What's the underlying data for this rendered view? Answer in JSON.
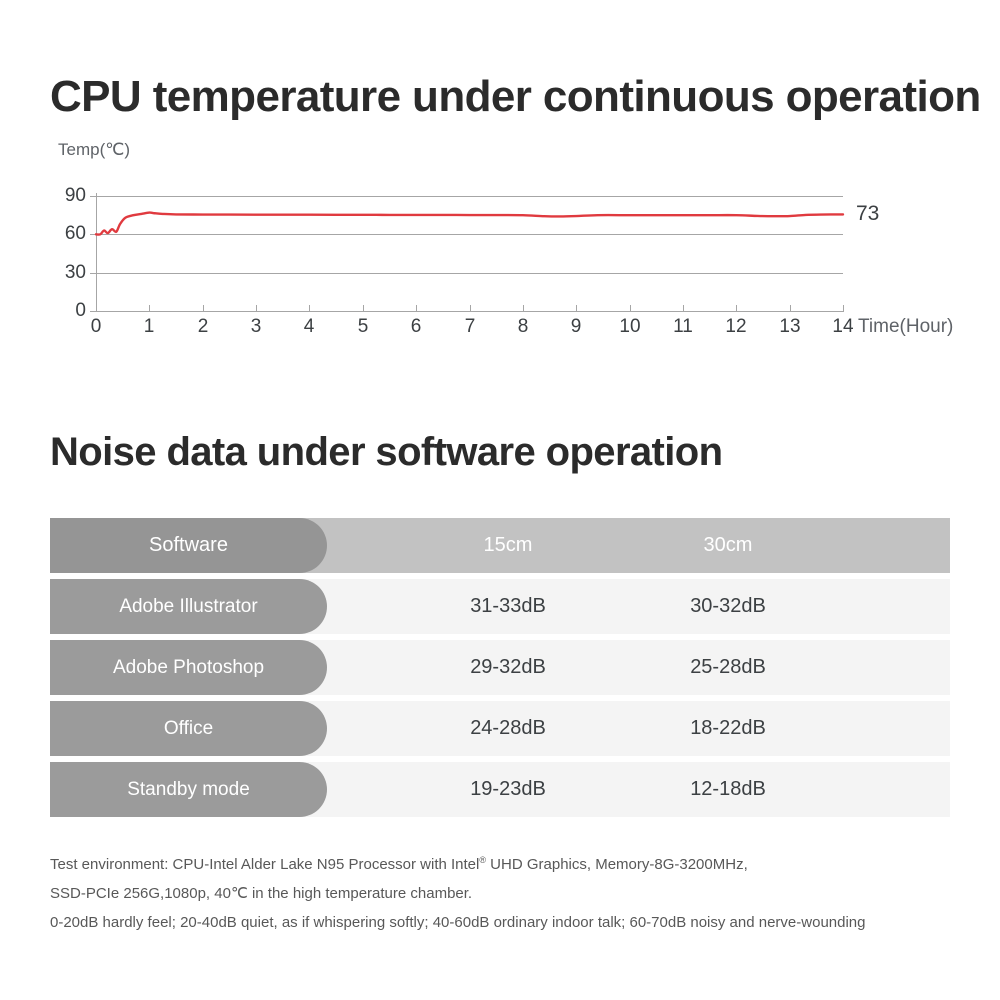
{
  "sections": {
    "cpu_title": "CPU temperature under continuous operation",
    "noise_title": "Noise data under software operation"
  },
  "chart_data": {
    "type": "line",
    "title": "CPU temperature under continuous operation",
    "xlabel": "Time(Hour)",
    "ylabel": "Temp(℃)",
    "xlim": [
      0,
      14
    ],
    "ylim": [
      0,
      100
    ],
    "grid": true,
    "legend": "none",
    "line_color": "#e03a3f",
    "gridline_color": "#a6a6a6",
    "y_ticks": [
      0,
      30,
      60,
      90
    ],
    "y_tick_labels": [
      "0",
      "30",
      "60",
      "90"
    ],
    "x_ticks": [
      0,
      1,
      2,
      3,
      4,
      5,
      6,
      7,
      8,
      9,
      10,
      11,
      12,
      13,
      14
    ],
    "x_tick_labels": [
      "0",
      "1",
      "2",
      "3",
      "4",
      "5",
      "6",
      "7",
      "8",
      "9",
      "10",
      "11",
      "12",
      "13",
      "14"
    ],
    "end_label": "73",
    "series": [
      {
        "name": "CPU temperature",
        "x": [
          0.0,
          0.08,
          0.15,
          0.22,
          0.3,
          0.38,
          0.45,
          0.55,
          0.7,
          0.85,
          1.0,
          1.1,
          1.25,
          1.5,
          2.0,
          2.5,
          3.0,
          3.5,
          4.0,
          4.5,
          5.0,
          5.5,
          6.0,
          6.5,
          7.0,
          7.5,
          8.0,
          8.4,
          8.7,
          9.0,
          9.4,
          10.0,
          10.5,
          11.0,
          11.5,
          12.0,
          12.4,
          12.7,
          13.0,
          13.3,
          13.6,
          14.0
        ],
        "values": [
          60,
          60,
          63,
          61,
          64,
          62,
          68,
          73,
          75,
          76,
          77,
          76.5,
          76,
          75.6,
          75.5,
          75.5,
          75.4,
          75.4,
          75.4,
          75.3,
          75.3,
          75.2,
          75.2,
          75.2,
          75.1,
          75.1,
          75.0,
          74.2,
          74.0,
          74.3,
          75.0,
          75.0,
          75.0,
          75.0,
          75.0,
          75.0,
          74.4,
          74.2,
          74.3,
          75.2,
          75.5,
          75.6
        ]
      }
    ]
  },
  "noise_table": {
    "columns": [
      "Software",
      "15cm",
      "30cm"
    ],
    "rows": [
      {
        "software": "Adobe Illustrator",
        "cm15": "31-33dB",
        "cm30": "30-32dB"
      },
      {
        "software": "Adobe Photoshop",
        "cm15": "29-32dB",
        "cm30": "25-28dB"
      },
      {
        "software": "Office",
        "cm15": "24-28dB",
        "cm30": "18-22dB"
      },
      {
        "software": "Standby mode",
        "cm15": "19-23dB",
        "cm30": "12-18dB"
      }
    ]
  },
  "footnotes": {
    "line1_a": "Test environment: CPU-Intel Alder Lake N95 Processor with Intel",
    "line1_sup": "®",
    "line1_b": " UHD Graphics,  Memory-8G-3200MHz,",
    "line2": "SSD-PCIe 256G,1080p, 40℃ in the high temperature chamber.",
    "line3": "0-20dB hardly feel; 20-40dB quiet, as if whispering softly; 40-60dB ordinary indoor talk; 60-70dB noisy and nerve-wounding"
  },
  "colors": {
    "line": "#e03a3f",
    "header_bar": "#c2c2c2",
    "header_pill": "#959595",
    "row_bg": "#f4f4f4",
    "row_pill": "#9b9b9b",
    "title": "#2b2b2b"
  }
}
